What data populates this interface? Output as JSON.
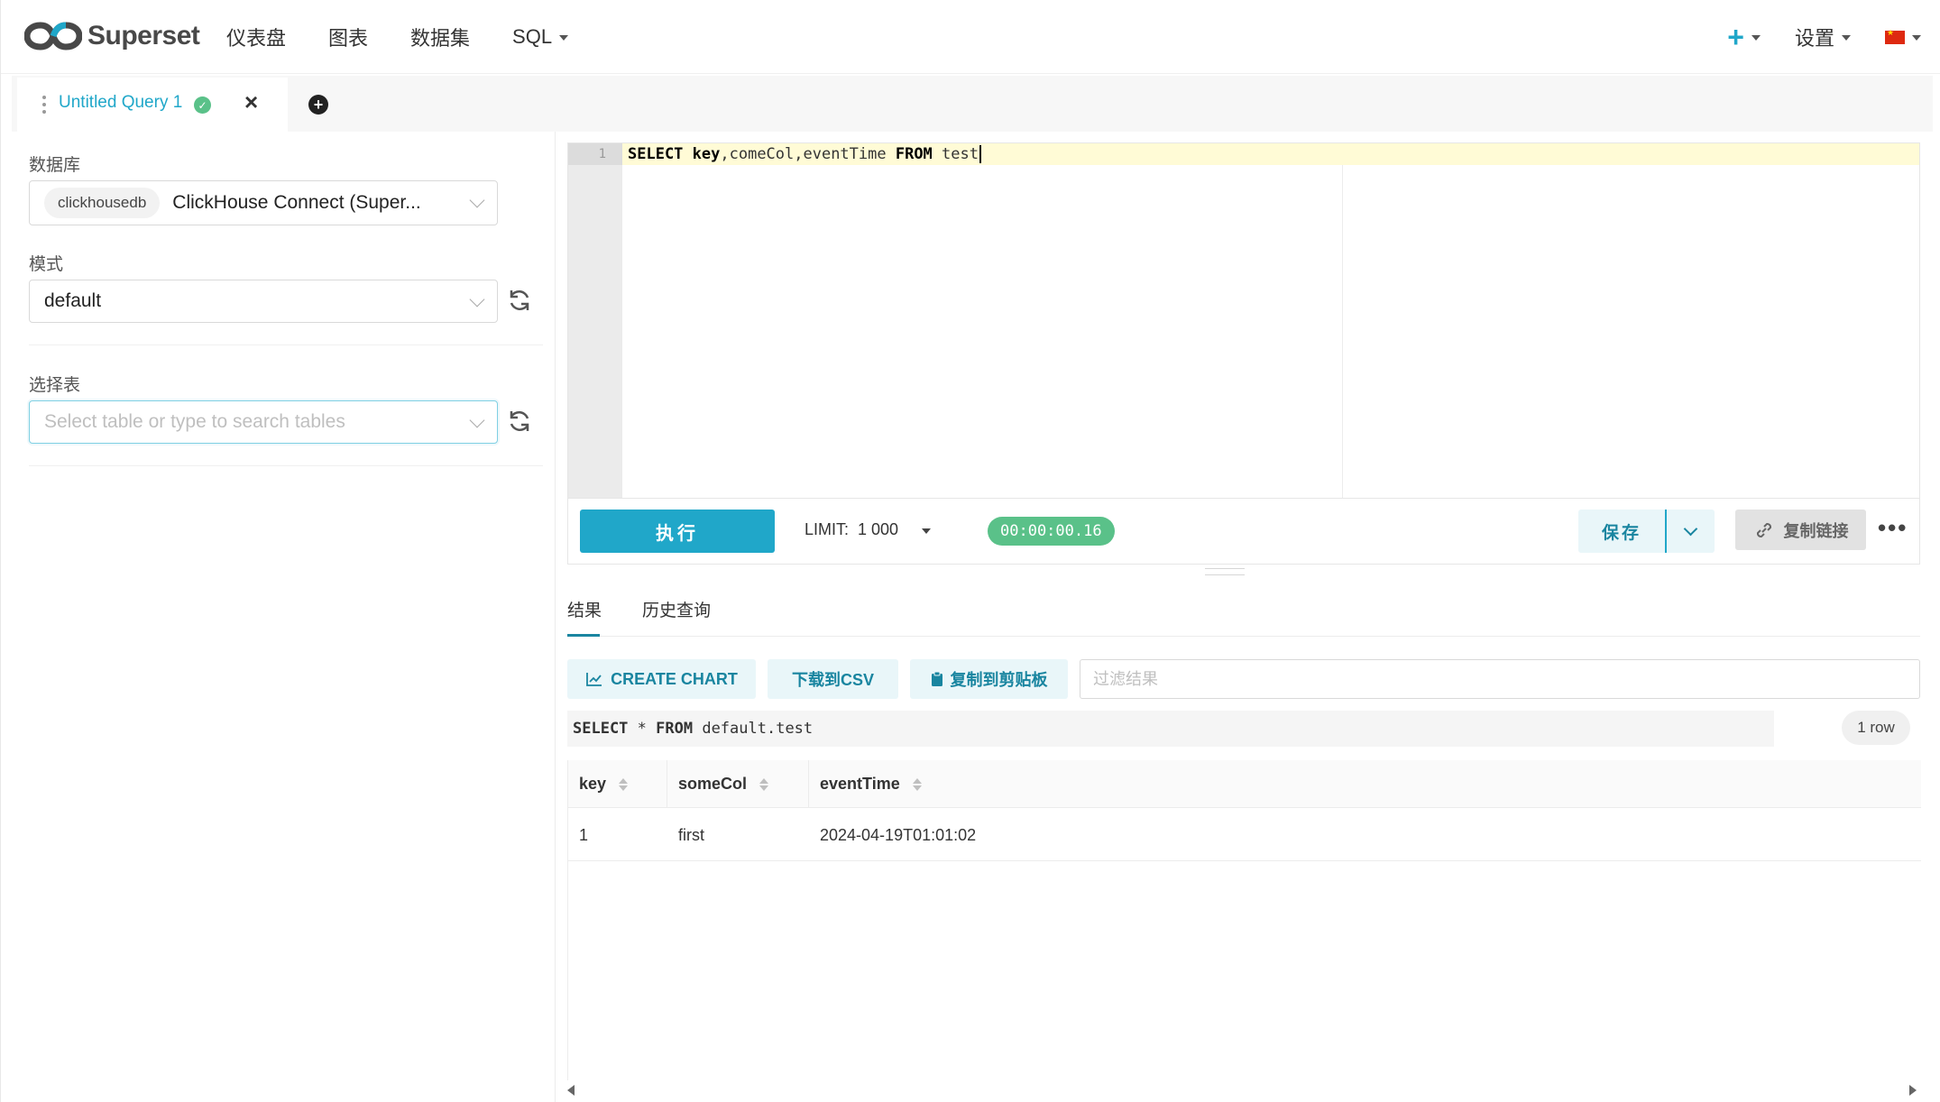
{
  "navbar": {
    "brand": "Superset",
    "menu": [
      {
        "label": "仪表盘"
      },
      {
        "label": "图表"
      },
      {
        "label": "数据集"
      },
      {
        "label": "SQL"
      }
    ],
    "plus_label": "+",
    "settings_label": "设置"
  },
  "tabs": {
    "active_label": "Untitled Query 1",
    "status": "success"
  },
  "left": {
    "database_label": "数据库",
    "database_tag": "clickhousedb",
    "database_value": "ClickHouse Connect (Super...",
    "schema_label": "模式",
    "schema_value": "default",
    "table_label": "选择表",
    "table_placeholder": "Select table or type to search tables"
  },
  "editor": {
    "line_number": "1",
    "code": {
      "kw1": "SELECT",
      "col1": " key",
      "rest": ",comeCol,eventTime ",
      "kw2": "FROM",
      "tail": " test"
    }
  },
  "toolbar": {
    "run_label": "执行",
    "limit_label": "LIMIT:",
    "limit_value": "1 000",
    "timer": "00:00:00.16",
    "save_label": "保存",
    "copy_link_label": "复制链接",
    "more_label": "•••"
  },
  "results": {
    "tab_results": "结果",
    "tab_history": "历史查询",
    "create_chart": "CREATE CHART",
    "download_csv": "下载到CSV",
    "copy_clipboard": "复制到剪贴板",
    "filter_placeholder": "过滤结果",
    "sql_parts": {
      "kw1": "SELECT",
      "mid": " * ",
      "kw2": "FROM",
      "tail": " default.test"
    },
    "row_count": "1 row",
    "columns": [
      "key",
      "someCol",
      "eventTime"
    ],
    "rows": [
      [
        "1",
        "first",
        "2024-04-19T01:01:02"
      ]
    ]
  },
  "colors": {
    "accent": "#20a7c9",
    "success": "#5ac189"
  }
}
